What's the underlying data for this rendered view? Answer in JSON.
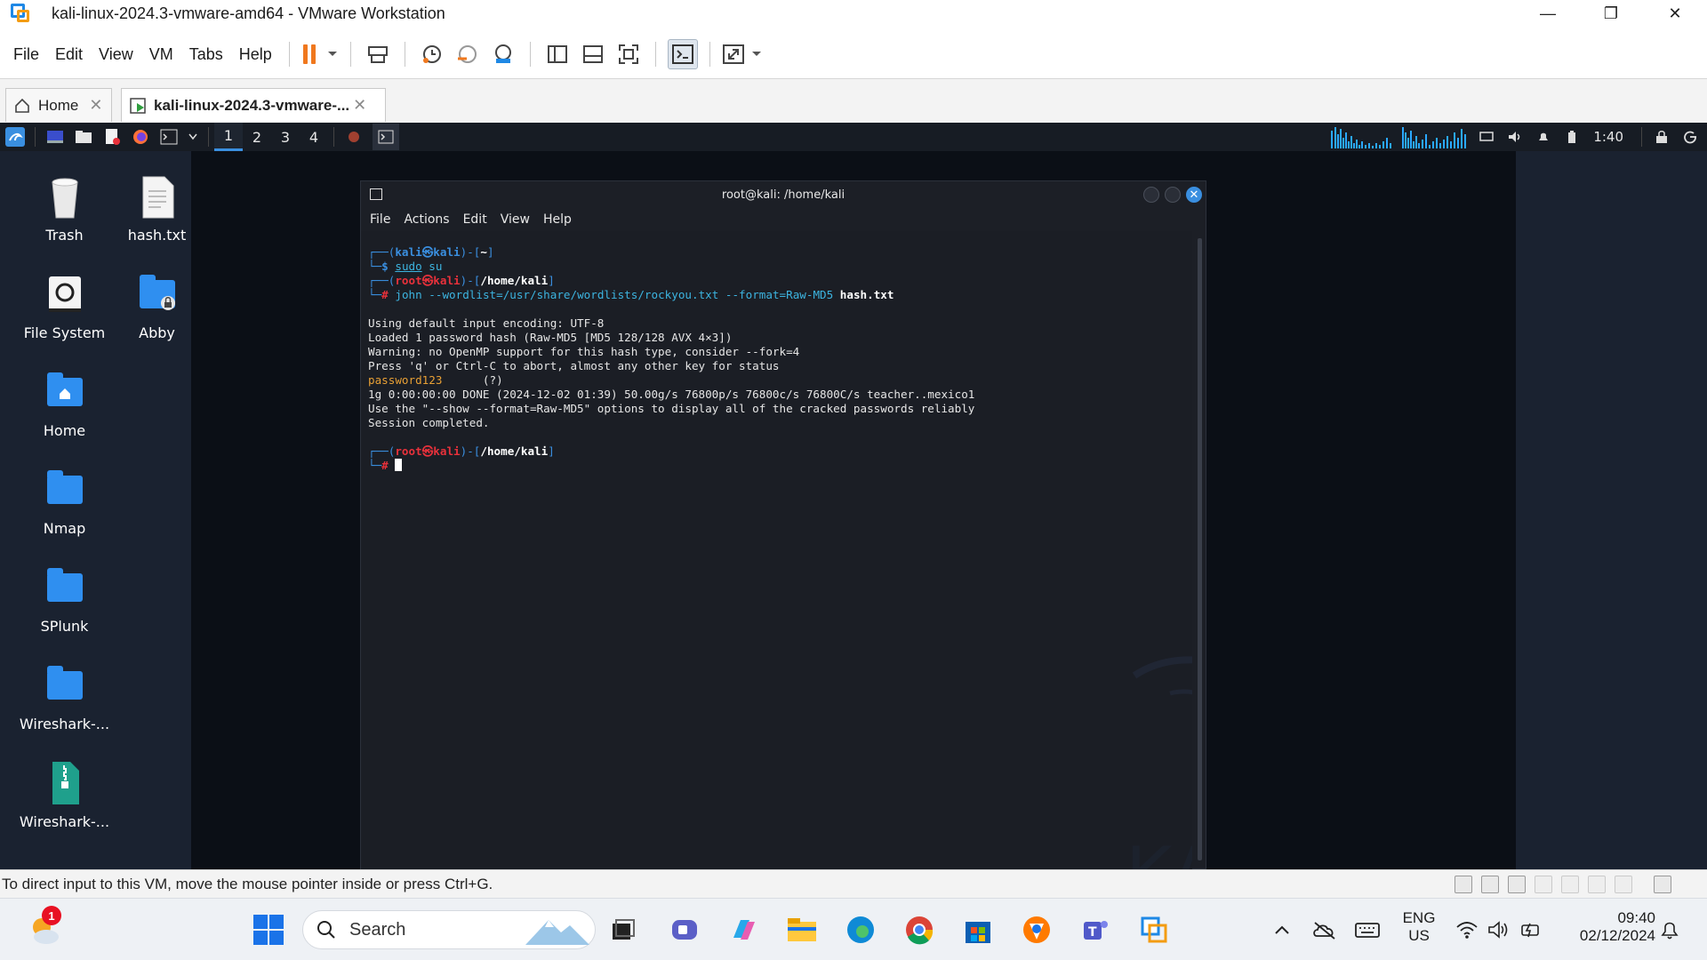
{
  "window": {
    "title": "kali-linux-2024.3-vmware-amd64 - VMware Workstation",
    "minimize": "—",
    "restore": "❐",
    "close": "✕"
  },
  "menubar": {
    "items": [
      "File",
      "Edit",
      "View",
      "VM",
      "Tabs",
      "Help"
    ],
    "underline": [
      "F",
      "E",
      "V",
      "V",
      "T",
      "H"
    ]
  },
  "tabs": [
    {
      "label": "Home",
      "close": "✕",
      "active": false
    },
    {
      "label": "kali-linux-2024.3-vmware-...",
      "close": "✕",
      "active": true
    }
  ],
  "kali_panel": {
    "workspaces": [
      "1",
      "2",
      "3",
      "4"
    ],
    "active_workspace": "1",
    "time": "1:40"
  },
  "desktop_icons": [
    {
      "label": "Trash",
      "icon": "trash-icon"
    },
    {
      "label": "hash.txt",
      "icon": "text-file-icon"
    },
    {
      "label": "File System",
      "icon": "drive-icon"
    },
    {
      "label": "Abby",
      "icon": "locked-folder-icon"
    },
    {
      "label": "Home",
      "icon": "home-folder-icon"
    },
    {
      "label": "Nmap",
      "icon": "folder-icon"
    },
    {
      "label": "SPlunk",
      "icon": "folder-icon"
    },
    {
      "label": "Wireshark-...",
      "icon": "folder-icon"
    },
    {
      "label": "Wireshark-...",
      "icon": "zip-file-icon"
    }
  ],
  "terminal": {
    "title": "root@kali: /home/kali",
    "menu": [
      "File",
      "Actions",
      "Edit",
      "View",
      "Help"
    ],
    "prompt1": {
      "open": "┌──(",
      "user": "kali",
      "at": "㉿",
      "host": "kali",
      "mid": ")-[",
      "path": "~",
      "close": "]",
      "second": "└─",
      "sym": "$",
      "cmd": "sudo",
      "args": " su"
    },
    "prompt2": {
      "open": "┌──(",
      "user": "root",
      "at": "㉿",
      "host": "kali",
      "mid": ")-[",
      "path": "/home/kali",
      "close": "]",
      "second": "└─",
      "sym": "#",
      "cmd": "john",
      "opts": " --wordlist=/usr/share/wordlists/rockyou.txt --format=Raw-MD5 ",
      "file": "hash.txt"
    },
    "output": [
      "Using default input encoding: UTF-8",
      "Loaded 1 password hash (Raw-MD5 [MD5 128/128 AVX 4×3])",
      "Warning: no OpenMP support for this hash type, consider --fork=4",
      "Press 'q' or Ctrl-C to abort, almost any other key for status"
    ],
    "cracked_password": "password123",
    "cracked_suffix": "      (?)",
    "output2": [
      "1g 0:00:00:00 DONE (2024-12-02 01:39) 50.00g/s 76800p/s 76800c/s 76800C/s teacher..mexico1",
      "Use the \"--show --format=Raw-MD5\" options to display all of the cracked passwords reliably",
      "Session completed."
    ],
    "prompt3": {
      "open": "┌──(",
      "user": "root",
      "at": "㉿",
      "host": "kali",
      "mid": ")-[",
      "path": "/home/kali",
      "close": "]",
      "second": "└─",
      "sym": "#"
    }
  },
  "statusbar": {
    "message": "To direct input to this VM, move the mouse pointer inside or press Ctrl+G."
  },
  "taskbar": {
    "search_placeholder": "Search",
    "weather_badge": "1",
    "lang_top": "ENG",
    "lang_bottom": "US",
    "time": "09:40",
    "date": "02/12/2024"
  },
  "colors": {
    "kali_blue": "#3a8fe0",
    "kali_red": "#e8313b",
    "cracked_orange": "#e8a035",
    "vmware_pause": "#f0781e"
  }
}
